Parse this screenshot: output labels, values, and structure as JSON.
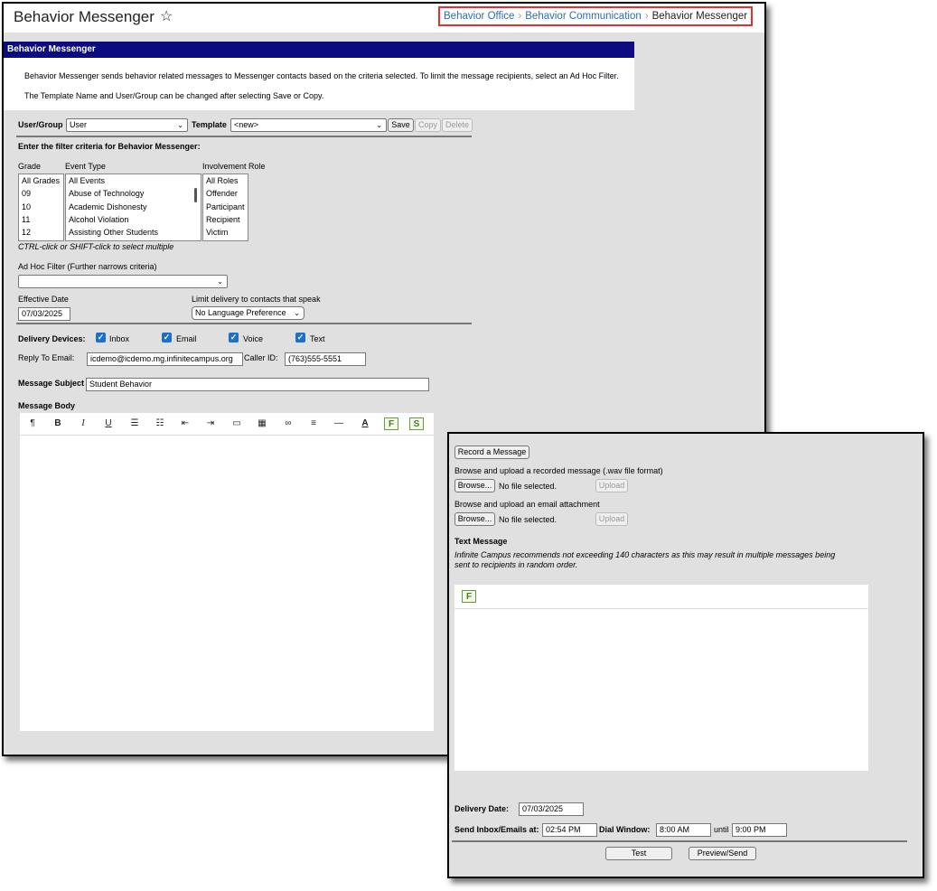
{
  "header": {
    "title": "Behavior Messenger",
    "breadcrumb": [
      "Behavior Office",
      "Behavior Communication",
      "Behavior Messenger"
    ]
  },
  "section": {
    "title": "Behavior Messenger",
    "info": [
      "Behavior Messenger sends behavior related messages to Messenger contacts based on the criteria selected. To limit the message recipients, select an Ad Hoc Filter.",
      "The Template Name and User/Group can be changed after selecting Save or Copy."
    ]
  },
  "template_row": {
    "user_group_label": "User/Group",
    "user_group_value": "User",
    "template_label": "Template",
    "template_value": "<new>",
    "save": "Save",
    "copy": "Copy",
    "delete": "Delete"
  },
  "filter": {
    "heading": "Enter the filter criteria for Behavior Messenger:",
    "grade_label": "Grade",
    "grades": [
      "All Grades",
      "09",
      "10",
      "11",
      "12"
    ],
    "event_type_label": "Event Type",
    "event_types": [
      "All Events",
      "Abuse of Technology",
      "Academic Dishonesty",
      "Alcohol Violation",
      "Assisting Other Students"
    ],
    "role_label": "Involvement Role",
    "roles": [
      "All Roles",
      "Offender",
      "Participant",
      "Recipient",
      "Victim"
    ],
    "multi_hint": "CTRL-click or SHIFT-click to select multiple",
    "adhoc_label": "Ad Hoc Filter (Further narrows criteria)",
    "adhoc_value": "",
    "effective_date_label": "Effective Date",
    "effective_date": "07/03/2025",
    "language_label": "Limit delivery to contacts that speak",
    "language_value": "No Language Preference"
  },
  "delivery": {
    "devices_label": "Delivery Devices:",
    "inbox": "Inbox",
    "email": "Email",
    "voice": "Voice",
    "text": "Text",
    "reply_label": "Reply To Email:",
    "reply_value": "icdemo@icdemo.mg.infinitecampus.org",
    "caller_label": "Caller ID:",
    "caller_value": "(763)555-5551",
    "subject_label": "Message Subject",
    "subject_value": "Student Behavior",
    "body_label": "Message Body"
  },
  "toolbar_icons": [
    "paragraph-icon",
    "bold-icon",
    "italic-icon",
    "underline-icon",
    "bullet-list-icon",
    "numbered-list-icon",
    "outdent-icon",
    "indent-icon",
    "image-icon",
    "table-icon",
    "link-icon",
    "align-icon",
    "horizontal-rule-icon",
    "font-color-icon",
    "field-icon",
    "sub-report-icon"
  ],
  "side": {
    "record_button": "Record a Message",
    "recorded_label": "Browse and upload a recorded message (.wav file format)",
    "browse": "Browse...",
    "no_file": "No file selected.",
    "upload": "Upload",
    "attachment_label": "Browse and upload an email attachment",
    "text_heading": "Text Message",
    "text_note_1": "Infinite Campus recommends not exceeding 140 characters as this may result in multiple messages being",
    "text_note_2": "sent to recipients in random order.",
    "delivery_date_label": "Delivery Date:",
    "delivery_date": "07/03/2025",
    "send_at_label": "Send Inbox/Emails at:",
    "send_at": "02:54 PM",
    "dial_window_label": "Dial Window:",
    "dial_start": "8:00 AM",
    "until": "until",
    "dial_end": "9:00 PM",
    "test": "Test",
    "preview_send": "Preview/Send"
  },
  "colors": {
    "section_bar": "#0c0c80",
    "link": "#2a6db5",
    "breadcrumb_highlight": "#e23030",
    "checkbox": "#1a6fd1"
  }
}
